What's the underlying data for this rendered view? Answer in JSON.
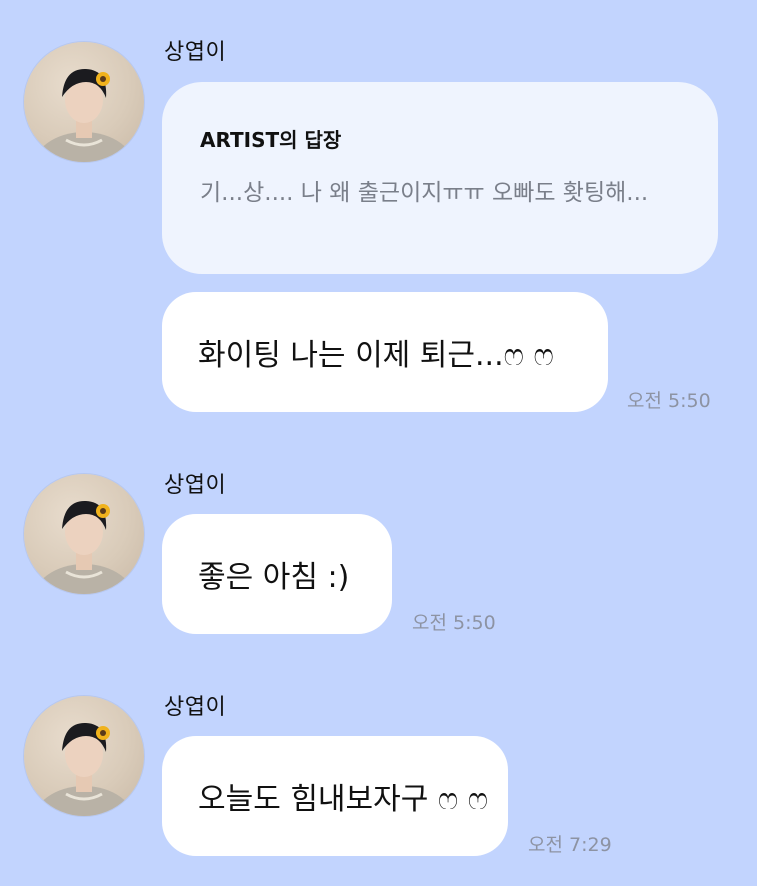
{
  "messages": [
    {
      "sender": "상엽이",
      "reply": {
        "title": "ARTIST의 답장",
        "text": "기...상.... 나 왜 출근이지ㅠㅠ 오빠도 홧팅해..."
      },
      "text": "화이팅 나는 이제 퇴근...ෆ ෆ",
      "time": "오전 5:50"
    },
    {
      "sender": "상엽이",
      "text": "좋은 아침 :)",
      "time": "오전 5:50"
    },
    {
      "sender": "상엽이",
      "text": "오늘도 힘내보자구 ෆ ෆ",
      "time": "오전 7:29"
    }
  ],
  "colors": {
    "background": "#c2d4fe",
    "bubble": "#ffffff",
    "reply_box": "#eff4fe",
    "time_text": "#8d93a3"
  },
  "icons": {
    "avatar": "profile-photo",
    "sunflower": "sunflower-accessory"
  }
}
